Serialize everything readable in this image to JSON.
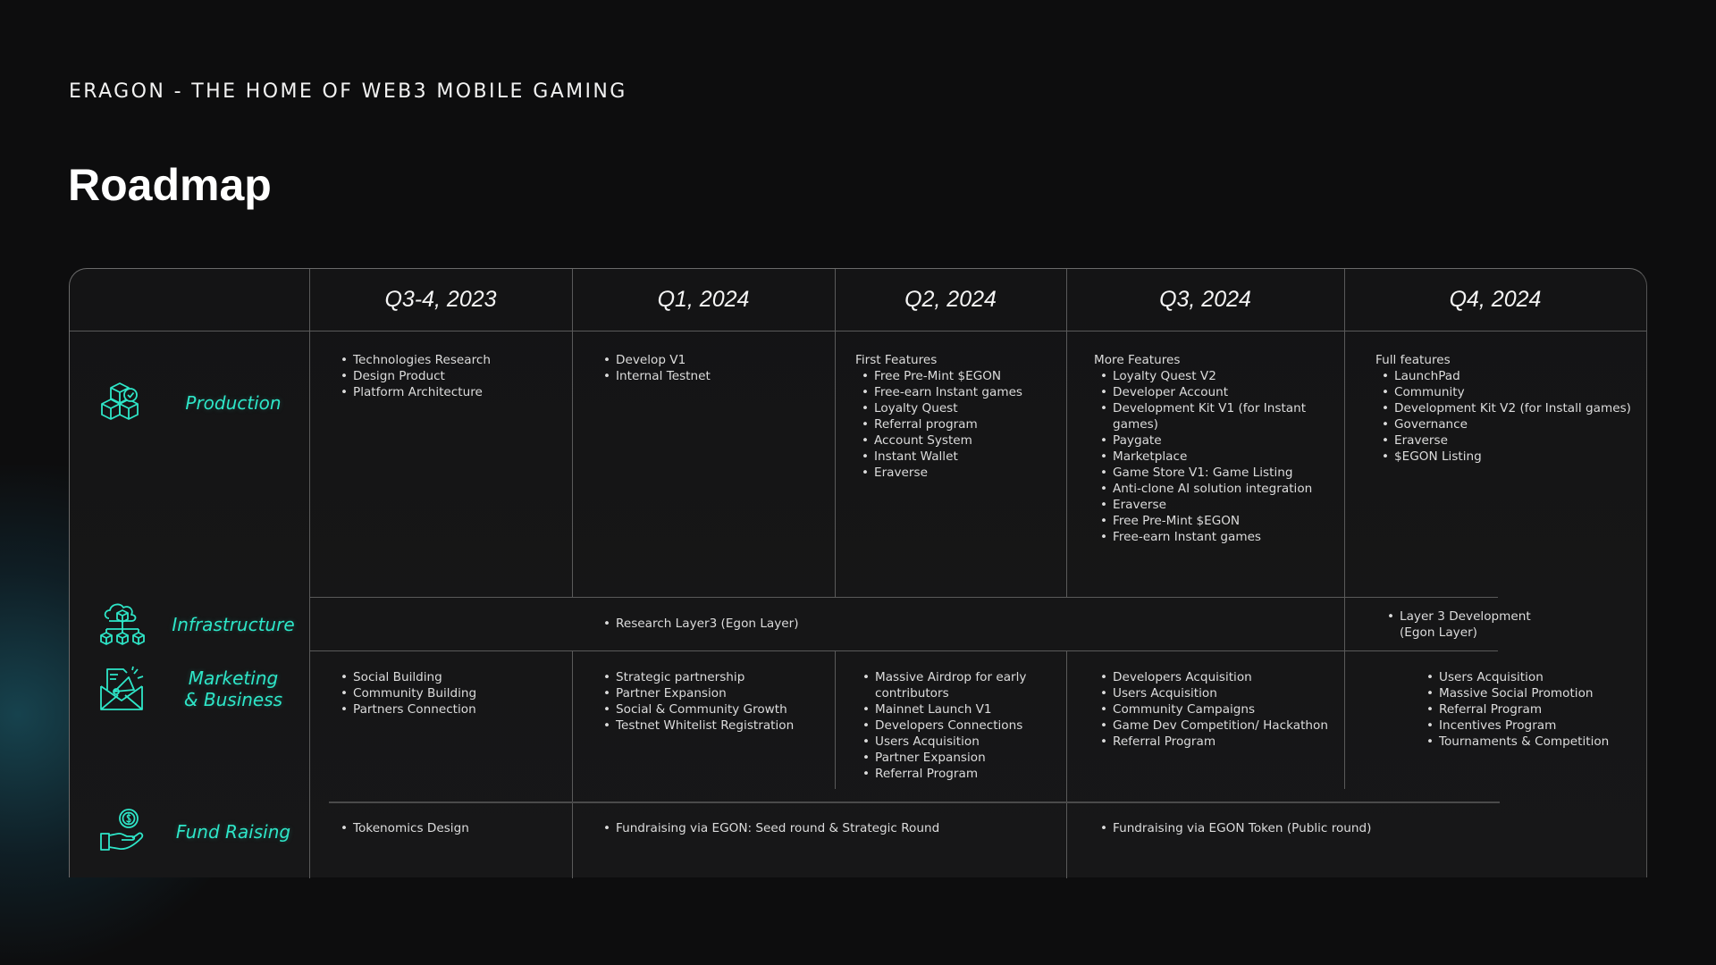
{
  "page": {
    "subtitle": "ERAGON - THE HOME OF WEB3 MOBILE GAMING",
    "title": "Roadmap"
  },
  "colors": {
    "accent": "#2ee6c8",
    "background": "#0d0d0e",
    "table": "#151516"
  },
  "columns": [
    "Q3-4, 2023",
    "Q1, 2024",
    "Q2, 2024",
    "Q3, 2024",
    "Q4, 2024"
  ],
  "categories": {
    "production": {
      "label": "Production",
      "icon": "cubes-check-icon"
    },
    "infrastructure": {
      "label": "Infrastructure",
      "icon": "cloud-network-icon"
    },
    "marketing": {
      "label_line1": "Marketing",
      "label_line2": "& Business",
      "icon": "megaphone-envelope-icon"
    },
    "fundraising": {
      "label": "Fund Raising",
      "icon": "hand-coin-icon"
    }
  },
  "production": {
    "q3_2023": {
      "items": [
        "Technologies Research",
        "Design Product",
        "Platform Architecture"
      ]
    },
    "q1_2024": {
      "items": [
        "Develop V1",
        "Internal Testnet"
      ]
    },
    "q2_2024": {
      "heading": "First Features",
      "items": [
        "Free Pre-Mint $EGON",
        "Free-earn Instant games",
        "Loyalty Quest",
        "Referral program",
        "Account System",
        "Instant Wallet",
        "Eraverse"
      ]
    },
    "q3_2024": {
      "heading": "More Features",
      "items": [
        "Loyalty Quest V2",
        "Developer Account",
        "Development Kit V1 (for Instant games)",
        "Paygate",
        "Marketplace",
        "Game Store V1: Game Listing",
        "Anti-clone AI solution integration",
        "Eraverse",
        "Free Pre-Mint $EGON",
        "Free-earn Instant games"
      ]
    },
    "q4_2024": {
      "heading": "Full features",
      "items": [
        "LaunchPad",
        "Community",
        "Development Kit V2 (for Install games)",
        "Governance",
        "Eraverse",
        "$EGON Listing"
      ]
    }
  },
  "infrastructure": {
    "q1_q3_2024": {
      "items": [
        "Research Layer3 (Egon Layer)"
      ]
    },
    "q4_2024": {
      "items": [
        "Layer 3 Development (Egon Layer)"
      ]
    }
  },
  "marketing": {
    "q3_2023": {
      "items": [
        "Social Building",
        "Community Building",
        "Partners Connection"
      ]
    },
    "q1_2024": {
      "items": [
        "Strategic partnership",
        "Partner Expansion",
        "Social & Community Growth",
        "Testnet Whitelist Registration"
      ]
    },
    "q2_2024": {
      "items": [
        "Massive Airdrop for early contributors",
        "Mainnet Launch V1",
        "Developers Connections",
        "Users Acquisition",
        "Partner Expansion",
        "Referral Program"
      ]
    },
    "q3_2024": {
      "items": [
        "Developers Acquisition",
        "Users Acquisition",
        "Community Campaigns",
        "Game Dev Competition/ Hackathon",
        "Referral Program"
      ]
    },
    "q4_2024": {
      "items": [
        "Users Acquisition",
        "Massive Social Promotion",
        "Referral Program",
        "Incentives Program",
        "Tournaments & Competition"
      ]
    }
  },
  "fundraising": {
    "q3_2023": {
      "items": [
        "Tokenomics Design"
      ]
    },
    "q1_q2_2024": {
      "items": [
        "Fundraising via EGON: Seed round & Strategic Round"
      ]
    },
    "q3_q4_2024": {
      "items": [
        "Fundraising via EGON Token (Public round)"
      ]
    }
  }
}
